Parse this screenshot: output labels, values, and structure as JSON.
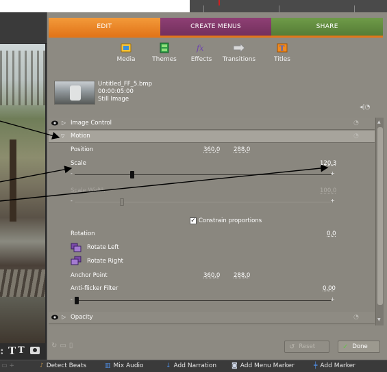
{
  "tabs": [
    {
      "label": "EDIT",
      "color": "#e98a2a"
    },
    {
      "label": "CREATE MENUS",
      "color": "#86386b"
    },
    {
      "label": "SHARE",
      "color": "#6a9544"
    }
  ],
  "tools": [
    {
      "label": "Media",
      "icon": "media-icon"
    },
    {
      "label": "Themes",
      "icon": "themes-icon"
    },
    {
      "label": "Effects",
      "icon": "effects-icon"
    },
    {
      "label": "Transitions",
      "icon": "transitions-icon"
    },
    {
      "label": "Titles",
      "icon": "titles-icon"
    }
  ],
  "clip": {
    "name": "Untitled_FF_5.bmp",
    "duration": "00:00:05:00",
    "type": "Still Image"
  },
  "sections": {
    "image_control": "Image Control",
    "motion": "Motion",
    "opacity": "Opacity"
  },
  "motion": {
    "position_label": "Position",
    "position_x": "360,0",
    "position_y": "288,0",
    "scale_label": "Scale",
    "scale_value": "120,3",
    "scale_slider_minus": "-",
    "scale_slider_plus": "+",
    "scale_fraction": 0.22,
    "scale_width_label": "Scale Width",
    "scale_width_value": "100,0",
    "scale_width_fraction": 0.18,
    "constrain_label": "Constrain proportions",
    "constrain_checked": "✓",
    "rotation_label": "Rotation",
    "rotation_value": "0,0",
    "rotate_left_label": "Rotate Left",
    "rotate_right_label": "Rotate Right",
    "anchor_label": "Anchor Point",
    "anchor_x": "360,0",
    "anchor_y": "288,0",
    "antiflicker_label": "Anti-flicker Filter",
    "antiflicker_value": "0,00",
    "antiflicker_fraction": 0.0
  },
  "buttons": {
    "reset": "Reset",
    "done": "Done"
  },
  "bottom_bar": [
    {
      "label": "Detect Beats",
      "icon": "metronome-icon"
    },
    {
      "label": "Mix Audio",
      "icon": "mixer-icon"
    },
    {
      "label": "Add Narration",
      "icon": "microphone-icon"
    },
    {
      "label": "Add Menu Marker",
      "icon": "menu-marker-icon"
    },
    {
      "label": "Add Marker",
      "icon": "marker-icon"
    }
  ]
}
